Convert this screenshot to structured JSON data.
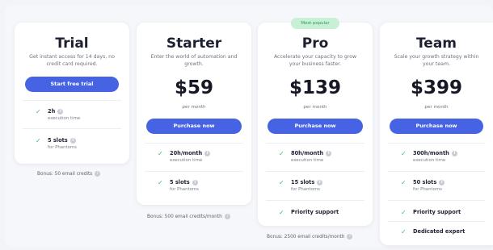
{
  "popular_badge": "Most popular",
  "plans": [
    {
      "name": "Trial",
      "description": "Get instant access for 14 days, no credit card required.",
      "cta": "Start free trial",
      "features": [
        {
          "main": "2h",
          "sub": "execution time",
          "info": true
        },
        {
          "main": "5 slots",
          "sub": "for Phantoms",
          "info": true
        }
      ],
      "bonus": "Bonus: 50 email credits"
    },
    {
      "name": "Starter",
      "description": "Enter the world of automation and growth.",
      "price": "$59",
      "period": "per month",
      "cta": "Purchase now",
      "features": [
        {
          "main": "20h/month",
          "sub": "execution time",
          "info": true
        },
        {
          "main": "5 slots",
          "sub": "for Phantoms",
          "info": true
        }
      ],
      "bonus": "Bonus: 500 email credits/month"
    },
    {
      "name": "Pro",
      "description": "Accelerate your capacity to grow your business faster.",
      "price": "$139",
      "period": "per month",
      "cta": "Purchase now",
      "features": [
        {
          "main": "80h/month",
          "sub": "execution time",
          "info": true
        },
        {
          "main": "15 slots",
          "sub": "for Phantoms",
          "info": true
        },
        {
          "main": "Priority support",
          "sub": "",
          "info": false
        }
      ],
      "bonus": "Bonus: 2500 email credits/month"
    },
    {
      "name": "Team",
      "description": "Scale your growth strategy within your team.",
      "price": "$399",
      "period": "per month",
      "cta": "Purchase now",
      "features": [
        {
          "main": "300h/month",
          "sub": "execution time",
          "info": true
        },
        {
          "main": "50 slots",
          "sub": "for Phantoms",
          "info": true
        },
        {
          "main": "Priority support",
          "sub": "",
          "info": false
        },
        {
          "main": "Dedicated expert",
          "sub": "",
          "info": false
        }
      ]
    }
  ],
  "colors": {
    "accent": "#4563e3",
    "check": "#45b86b",
    "badge_bg": "#c8f0d6",
    "badge_text": "#2f9a56"
  },
  "icons": {
    "check": "check-icon",
    "info": "info-icon"
  }
}
